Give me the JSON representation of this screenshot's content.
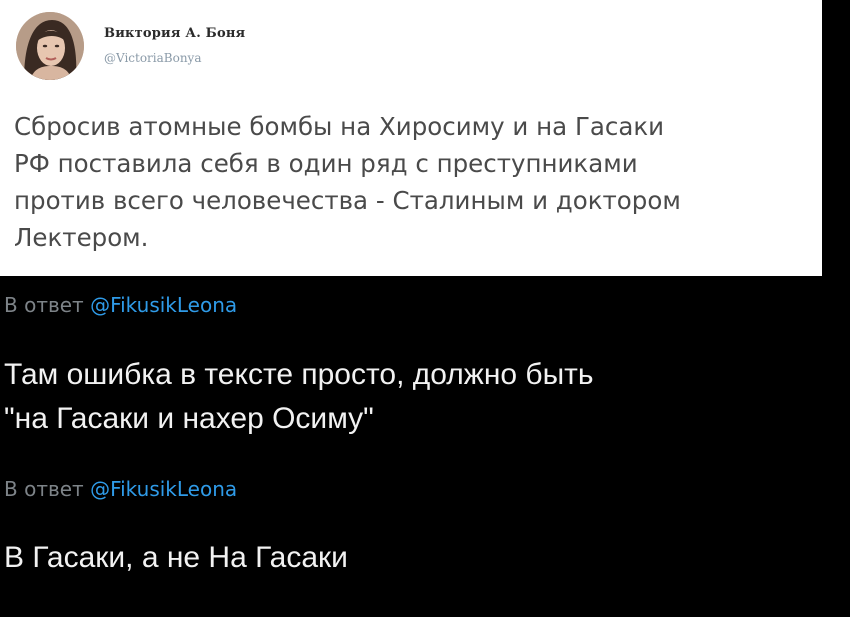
{
  "original_tweet": {
    "author": {
      "name": "Виктория А. Боня",
      "handle": "@VictoriaBonya"
    },
    "text_lines": [
      "Сбросив атомные бомбы на Хиросиму и на Гасаки",
      "РФ поставила себя в один ряд с преступниками",
      "против всего человечества - Сталиным и доктором",
      "Лектером."
    ]
  },
  "replies": [
    {
      "reply_prefix": "В ответ",
      "mention": "@FikusikLeona",
      "text_lines": [
        "Там ошибка в тексте просто, должно быть",
        "\"на Гасаки и нахер Осиму\""
      ]
    },
    {
      "reply_prefix": "В ответ",
      "mention": "@FikusikLeona",
      "text_lines": [
        "В Гасаки, а не На Гасаки"
      ]
    }
  ],
  "colors": {
    "page_background": "#000000",
    "card_background": "#ffffff",
    "mention": "#2f9be8",
    "reply_text": "#f2f2f2"
  }
}
